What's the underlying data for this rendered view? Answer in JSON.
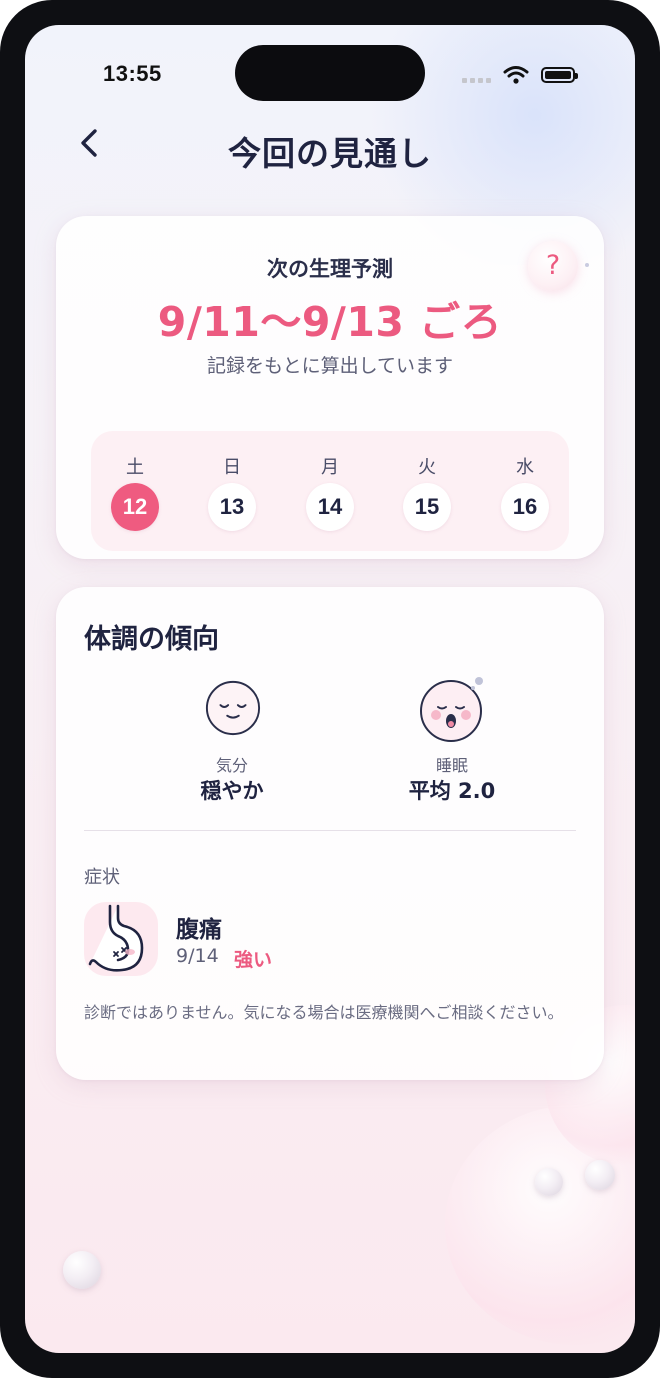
{
  "status_bar": {
    "time": "13:55"
  },
  "header": {
    "title": "今回の見通し",
    "back_icon": "chevron-left-icon"
  },
  "prediction": {
    "label": "次の生理予測",
    "range": "9/11〜9/13 ごろ",
    "note": "記録をもとに算出しています",
    "help_label": "?",
    "days": [
      {
        "weekday": "土",
        "date": "12",
        "selected": true
      },
      {
        "weekday": "日",
        "date": "13",
        "selected": false
      },
      {
        "weekday": "月",
        "date": "14",
        "selected": false
      },
      {
        "weekday": "火",
        "date": "15",
        "selected": false
      },
      {
        "weekday": "水",
        "date": "16",
        "selected": false
      }
    ]
  },
  "trend": {
    "title": "体調の傾向",
    "mood": {
      "label": "気分",
      "value": "穏やか",
      "icon": "calm-face-icon"
    },
    "sleep": {
      "label": "睡眠",
      "value": "平均 2.0",
      "icon": "yawning-face-icon"
    },
    "symptoms_label": "症状",
    "symptom": {
      "name": "腹痛",
      "date": "9/14",
      "severity": "強い",
      "icon": "stomach-icon"
    },
    "disclaimer": "診断ではありません。気になる場合は医療機関へご相談ください。"
  },
  "colors": {
    "accent": "#ec5a80",
    "text": "#1f2340",
    "muted": "#5e6078",
    "card": "#ffffff"
  }
}
